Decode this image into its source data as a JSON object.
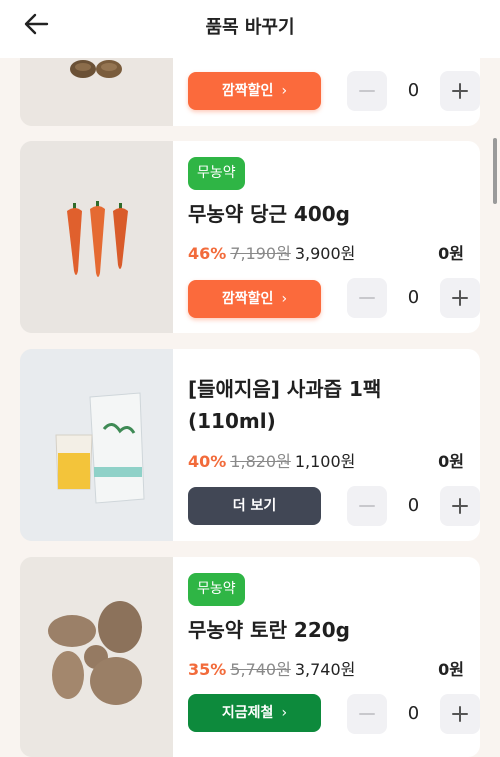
{
  "header": {
    "title": "품목 바꾸기",
    "back_icon": "arrow-left-icon"
  },
  "products": [
    {
      "badge": "",
      "name": "",
      "discount": "",
      "original_price": "",
      "price": "",
      "subtotal": "",
      "cta": "깜짝할인",
      "quantity": "0"
    },
    {
      "badge": "무농약",
      "name": "무농약 당근 400g",
      "discount": "46%",
      "original_price": "7,190원",
      "price": "3,900원",
      "subtotal": "0원",
      "cta": "깜짝할인",
      "quantity": "0"
    },
    {
      "badge": "",
      "name_line1": "[들애지음] 사과즙 1팩",
      "name_line2": "(110ml)",
      "discount": "40%",
      "original_price": "1,820원",
      "price": "1,100원",
      "subtotal": "0원",
      "cta": "더 보기",
      "quantity": "0"
    },
    {
      "badge": "무농약",
      "name": "무농약 토란 220g",
      "discount": "35%",
      "original_price": "5,740원",
      "price": "3,740원",
      "subtotal": "0원",
      "cta": "지금제철",
      "quantity": "0"
    }
  ],
  "colors": {
    "accent_orange": "#fb6a3c",
    "discount_text": "#f26b3b",
    "badge_green": "#2fb545",
    "cta_dark": "#414755",
    "cta_green": "#0d8a3c"
  },
  "icons": [
    "minus-icon",
    "plus-icon",
    "chevron-right-icon"
  ]
}
